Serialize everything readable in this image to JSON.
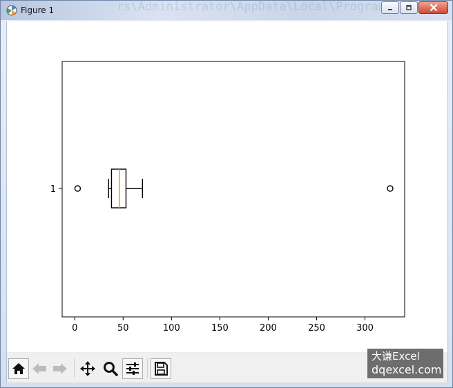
{
  "window": {
    "title": "Figure 1",
    "background_ghost_text": "rs\\Administrator\\AppData\\Local\\Programs"
  },
  "toolbar": {
    "tools": [
      {
        "name": "home-button",
        "icon": "home-icon"
      },
      {
        "name": "back-button",
        "icon": "arrow-left-icon"
      },
      {
        "name": "forward-button",
        "icon": "arrow-right-icon"
      },
      {
        "name": "pan-button",
        "icon": "move-icon"
      },
      {
        "name": "zoom-button",
        "icon": "magnifier-icon"
      },
      {
        "name": "configure-subplots-button",
        "icon": "sliders-icon"
      },
      {
        "name": "save-button",
        "icon": "floppy-disk-icon"
      }
    ]
  },
  "watermark": {
    "line1": "大谦Excel",
    "line2": "dqexcel.com"
  },
  "chart_data": {
    "type": "boxplot",
    "orientation": "horizontal",
    "categories": [
      "1"
    ],
    "x_ticks": [
      0,
      50,
      100,
      150,
      200,
      250,
      300
    ],
    "xlim": [
      -13,
      341
    ],
    "box": {
      "whisker_low": 35,
      "q1": 38,
      "median": 46,
      "q3": 53,
      "whisker_high": 70
    },
    "outliers": [
      3,
      326
    ],
    "colors": {
      "box": "#000000",
      "median": "#ff7f0e"
    }
  }
}
